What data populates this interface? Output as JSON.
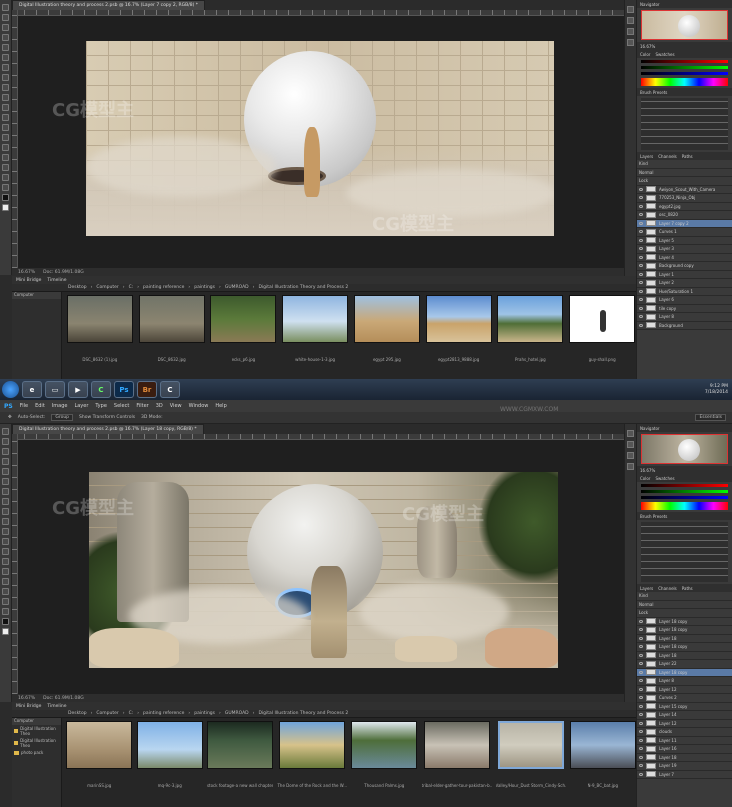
{
  "top": {
    "doc_tab": "Digital Illustration theory and process 2.psb @ 16.7% (Layer 7 copy 2, RGB/8) *",
    "status": {
      "zoom": "16.67%",
      "doc": "Doc: 61.9M/1.08G"
    },
    "navigator_label": "Navigator",
    "zoom": "16.67%",
    "color_tabs": [
      "Color",
      "Swatches"
    ],
    "brush_tabs": [
      "Brush Presets"
    ],
    "layers_tabs": [
      "Layers",
      "Channels",
      "Paths"
    ],
    "layers": [
      "Kind",
      "Normal",
      "Lock",
      "Awiyon_Scout_With_Camera",
      "770253_Ninja_Obj",
      "egypt2.jpg",
      "osc_0820",
      "Layer 7 copy 2",
      "Curves 1",
      "Layer 5",
      "Layer 3",
      "Layer 4",
      "Background copy",
      "Layer 1",
      "Layer 2",
      "Hue/Saturation 1",
      "Layer 6",
      "tile copy",
      "Layer 8",
      "Background"
    ],
    "bridge": {
      "tabs": [
        "Mini Bridge",
        "Timeline"
      ],
      "path": [
        "Desktop",
        "Computer",
        "C:",
        "painting reference",
        "paintings",
        "GUMROAD",
        "Digital Illustration Theory and Process 2"
      ],
      "folder_header": "Computer",
      "thumbs": [
        "DSC_8632 (1).jpg",
        "DSC_8632.jpg",
        "ecks_p6.jpg",
        "white-house-1-3.jpg",
        "egypt 295.jpg",
        "egypt2813_9888.jpg",
        "Prahs_hotel.jpg",
        "guy-shall.png"
      ]
    }
  },
  "taskbar": {
    "apps": [
      "Ps",
      "Br"
    ],
    "time": "9:12 PM",
    "date": "7/18/2014"
  },
  "bottom": {
    "menu": [
      "PS",
      "File",
      "Edit",
      "Image",
      "Layer",
      "Type",
      "Select",
      "Filter",
      "3D",
      "View",
      "Window",
      "Help"
    ],
    "options": {
      "auto_select": "Auto-Select:",
      "group": "Group",
      "transform": "Show Transform Controls",
      "mode": "3D Mode:",
      "workspace": "Essentials"
    },
    "doc_tab": "Digital Illustration theory and process 2.psb @ 16.7% (Layer 18 copy, RGB/8) *",
    "status": {
      "zoom": "16.67%",
      "doc": "Doc: 61.9M/1.08G"
    },
    "navigator_label": "Navigator",
    "zoom": "16.67%",
    "color_tabs": [
      "Color",
      "Swatches"
    ],
    "brush_tabs": [
      "Brush Presets"
    ],
    "layers_tabs": [
      "Layers",
      "Channels",
      "Paths"
    ],
    "layers": [
      "Kind",
      "Normal",
      "Lock",
      "Layer 18 copy",
      "Layer 18 copy",
      "Layer 18",
      "Layer 18 copy",
      "Layer 18",
      "Layer 22",
      "Layer 18 copy",
      "Layer 8",
      "Layer 12",
      "Curves 2",
      "Layer 15 copy",
      "Layer 14",
      "Layer 12",
      "clouds",
      "Layer 11",
      "Layer 16",
      "Layer 18",
      "Layer 19",
      "Layer 7"
    ],
    "bridge": {
      "tabs": [
        "Mini Bridge",
        "Timeline"
      ],
      "path": [
        "Desktop",
        "Computer",
        "C:",
        "painting reference",
        "paintings",
        "GUMROAD",
        "Digital Illustration Theory and Process 2"
      ],
      "folder_header": "Computer",
      "folders": [
        "Digital Illustration Theo",
        "Digital Illustration Theo",
        "photo pack"
      ],
      "thumbs": [
        "marinSS.jpg",
        "mq-9c-3.jpg",
        "stock footage-a new wall chapter",
        "The Dome of the Rock and the W...",
        "Thousand Palms.jpg",
        "tribal-elder-gather-tour-pakistan-b...",
        "Valley/Hour_Dust Storm_Cindy-Sch...",
        "N-9_BC_bat.jpg"
      ]
    }
  },
  "watermark": {
    "logo": "CG模型主",
    "url": "WWW.CGMXW.COM"
  },
  "colors": {
    "panel_bg": "#3a3a3a",
    "canvas_bg": "#1f1f1f",
    "selected_layer": "#5a7aa6",
    "accent": "#31a8ff"
  }
}
